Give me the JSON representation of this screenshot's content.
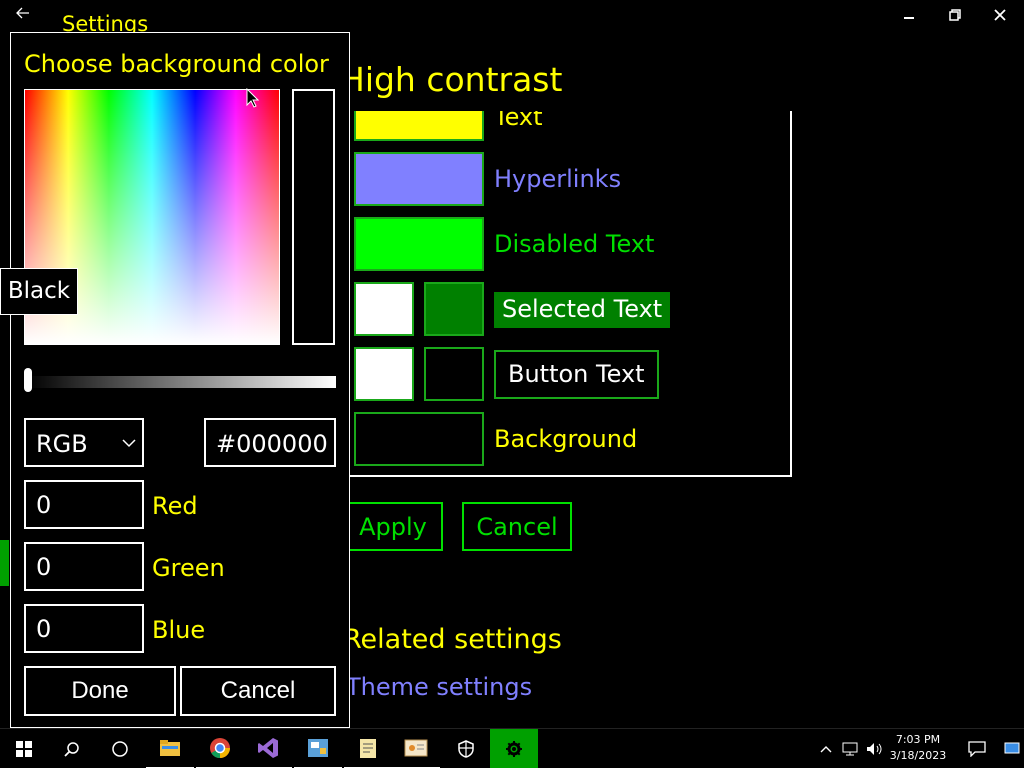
{
  "window": {
    "title": "Settings",
    "back_icon": "back-arrow-icon",
    "minimize_icon": "minimize-icon",
    "restore_icon": "restore-icon",
    "close_icon": "close-icon"
  },
  "main": {
    "title": "High contrast",
    "swatches": {
      "text": {
        "label": "Text",
        "color": "#ffff00"
      },
      "hyperlinks": {
        "label": "Hyperlinks",
        "color": "#8080ff"
      },
      "disabled": {
        "label": "Disabled Text",
        "color": "#00ff00"
      },
      "selected": {
        "label": "Selected Text",
        "fg": "#ffffff",
        "bg": "#008000"
      },
      "button": {
        "label": "Button Text",
        "fg": "#ffffff",
        "bg": "#000000"
      },
      "background": {
        "label": "Background",
        "color": "#000000"
      }
    },
    "apply_label": "Apply",
    "cancel_label": "Cancel",
    "related_title": "Related settings",
    "theme_link": "Theme settings"
  },
  "dialog": {
    "title": "Choose background color",
    "mode_select": {
      "value": "RGB"
    },
    "hex_value": "#000000",
    "red": {
      "value": "0",
      "label": "Red"
    },
    "green": {
      "value": "0",
      "label": "Green"
    },
    "blue": {
      "value": "0",
      "label": "Blue"
    },
    "done_label": "Done",
    "cancel_label": "Cancel",
    "tooltip": "Black"
  },
  "taskbar": {
    "time": "7:03 PM",
    "date": "3/18/2023",
    "items": [
      "start-icon",
      "search-icon",
      "task-view-icon",
      "file-explorer-icon",
      "chrome-icon",
      "visual-studio-icon",
      "app-icon",
      "notepad-icon",
      "certificate-icon",
      "security-icon",
      "settings-icon"
    ]
  }
}
